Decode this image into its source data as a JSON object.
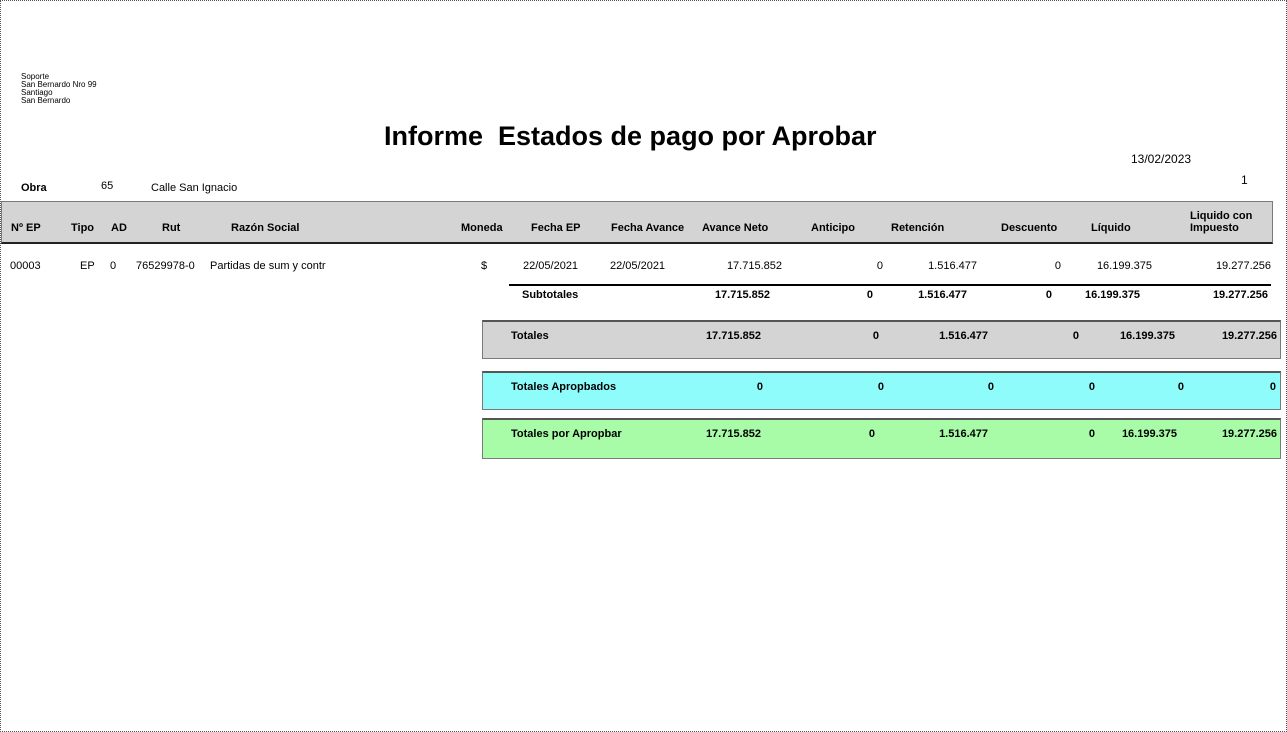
{
  "company": {
    "line1": "Soporte",
    "line2": "San Bernardo Nro 99",
    "line3": "Santiago",
    "line4": "San Bernardo"
  },
  "report_title": "Informe  Estados de pago por Aprobar",
  "date": "13/02/2023",
  "page_number": "1",
  "obra": {
    "label": "Obra",
    "number": "65",
    "name": "Calle San Ignacio"
  },
  "columns": {
    "nep": "Nº EP",
    "tipo": "Tipo",
    "ad": "AD",
    "rut": "Rut",
    "razon": "Razón Social",
    "moneda": "Moneda",
    "fecha_ep": "Fecha EP",
    "fecha_avance": "Fecha Avance",
    "avance_neto": "Avance Neto",
    "anticipo": "Anticipo",
    "retencion": "Retención",
    "descuento": "Descuento",
    "liquido": "Líquido",
    "liquido_imp_1": "Liquido con",
    "liquido_imp_2": "Impuesto"
  },
  "row": {
    "nep": "00003",
    "tipo": "EP",
    "ad": "0",
    "rut": "76529978-0",
    "razon": "Partidas de sum y contr",
    "moneda": "$",
    "fecha_ep": "22/05/2021",
    "fecha_avance": "22/05/2021",
    "avance_neto": "17.715.852",
    "anticipo": "0",
    "retencion": "1.516.477",
    "descuento": "0",
    "liquido": "16.199.375",
    "liquido_imp": "19.277.256"
  },
  "subtotales": {
    "label": "Subtotales",
    "avance_neto": "17.715.852",
    "anticipo": "0",
    "retencion": "1.516.477",
    "descuento": "0",
    "liquido": "16.199.375",
    "liquido_imp": "19.277.256"
  },
  "totales": {
    "label": "Totales",
    "avance_neto": "17.715.852",
    "anticipo": "0",
    "retencion": "1.516.477",
    "descuento": "0",
    "liquido": "16.199.375",
    "liquido_imp": "19.277.256",
    "color": "#d4d4d4"
  },
  "totales_aprobados": {
    "label": "Totales Apropbados",
    "avance_neto": "0",
    "anticipo": "0",
    "retencion": "0",
    "descuento": "0",
    "liquido": "0",
    "liquido_imp": "0",
    "color": "#8ffcfc"
  },
  "totales_por_aprobar": {
    "label": "Totales por Apropbar",
    "avance_neto": "17.715.852",
    "anticipo": "0",
    "retencion": "1.516.477",
    "descuento": "0",
    "liquido": "16.199.375",
    "liquido_imp": "19.277.256",
    "color": "#a8fca8"
  }
}
